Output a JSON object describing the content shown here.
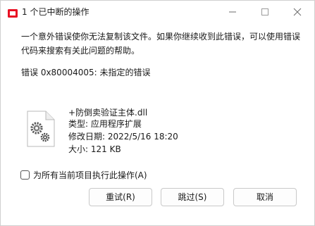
{
  "window": {
    "title": "1 个已中断的操作",
    "controls": {
      "minimize": "minimize-icon",
      "maximize": "maximize-icon",
      "close": "close-icon"
    }
  },
  "message": {
    "body": "一个意外错误使你无法复制该文件。如果你继续收到此错误，可以使用错误代码来搜索有关此问题的帮助。",
    "error_line": "错误 0x80004005: 未指定的错误"
  },
  "file": {
    "icon": "settings-file-icon",
    "name": "+防倒卖验证主体.dll",
    "type": "类型: 应用程序扩展",
    "modified": "修改日期: 2022/5/16 18:20",
    "size": "大小: 121 KB"
  },
  "checkbox": {
    "label": "为所有当前项目执行此操作(A)",
    "checked": false
  },
  "buttons": {
    "retry": "重试(R)",
    "skip": "跳过(S)",
    "cancel": "取消"
  },
  "colors": {
    "title_icon": "#e81123",
    "button_border": "#c9c9c9",
    "icon_gear": "#5a5a5a"
  }
}
